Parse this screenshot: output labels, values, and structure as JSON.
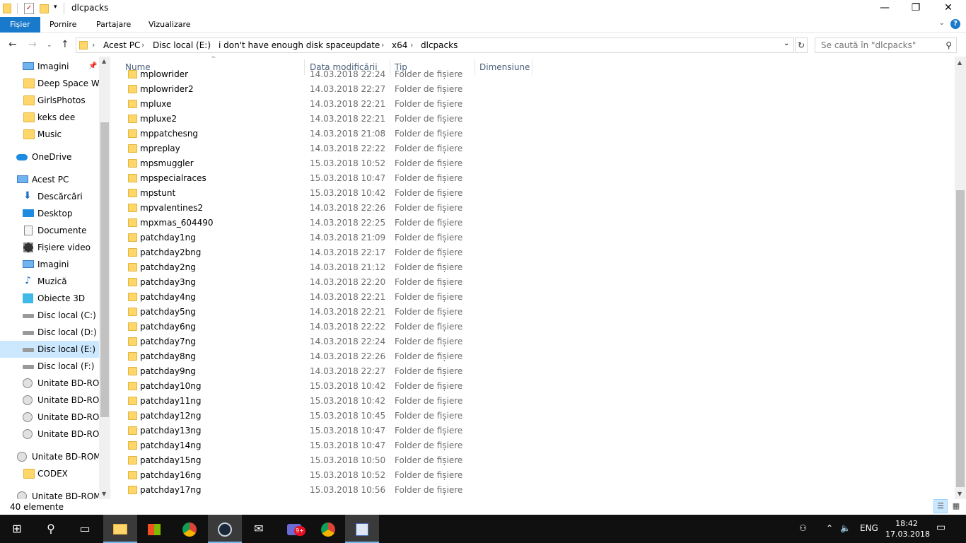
{
  "window": {
    "title": "dlcpacks"
  },
  "ribbon": {
    "tabs": [
      "Fișier",
      "Pornire",
      "Partajare",
      "Vizualizare"
    ]
  },
  "address": {
    "crumbs": [
      "Acest PC",
      "Disc local (E:)",
      "i don't have enough disk space",
      "update",
      "x64",
      "dlcpacks"
    ]
  },
  "search": {
    "placeholder": "Se caută în \"dlcpacks\""
  },
  "nav": {
    "items": [
      {
        "label": "Imagini",
        "icon": "pictures-icon"
      },
      {
        "label": "Deep Space Waifu",
        "icon": "folder-icon"
      },
      {
        "label": "GirlsPhotos",
        "icon": "folder-icon"
      },
      {
        "label": "keks dee",
        "icon": "folder-icon"
      },
      {
        "label": "Music",
        "icon": "folder-icon"
      },
      {
        "label": "OneDrive",
        "icon": "onedrive-icon"
      },
      {
        "label": "Acest PC",
        "icon": "this-pc-icon"
      },
      {
        "label": "Descărcări",
        "icon": "downloads-icon"
      },
      {
        "label": "Desktop",
        "icon": "desktop-icon"
      },
      {
        "label": "Documente",
        "icon": "documents-icon"
      },
      {
        "label": "Fișiere video",
        "icon": "videos-icon"
      },
      {
        "label": "Imagini",
        "icon": "pictures-icon"
      },
      {
        "label": "Muzică",
        "icon": "music-icon"
      },
      {
        "label": "Obiecte 3D",
        "icon": "objects-3d-icon"
      },
      {
        "label": "Disc local (C:)",
        "icon": "drive-icon"
      },
      {
        "label": "Disc local (D:)",
        "icon": "drive-icon"
      },
      {
        "label": "Disc local (E:)",
        "icon": "drive-icon"
      },
      {
        "label": "Disc local (F:)",
        "icon": "drive-icon"
      },
      {
        "label": "Unitate BD-ROM",
        "icon": "bd-drive-icon"
      },
      {
        "label": "Unitate BD-ROM",
        "icon": "bd-drive-icon"
      },
      {
        "label": "Unitate BD-ROM",
        "icon": "bd-drive-icon"
      },
      {
        "label": "Unitate BD-ROM",
        "icon": "disc-icon"
      },
      {
        "label": "Unitate BD-ROM (",
        "icon": "bd-drive-icon"
      },
      {
        "label": "CODEX",
        "icon": "folder-icon"
      },
      {
        "label": "Unitate BD-ROM (",
        "icon": "bd-drive-icon"
      }
    ]
  },
  "columns": {
    "name": "Nume",
    "date": "Data modificării",
    "type": "Tip",
    "size": "Dimensiune"
  },
  "files": [
    {
      "name": "mplowrider",
      "date": "14.03.2018 22:24",
      "type": "Folder de fișiere"
    },
    {
      "name": "mplowrider2",
      "date": "14.03.2018 22:27",
      "type": "Folder de fișiere"
    },
    {
      "name": "mpluxe",
      "date": "14.03.2018 22:21",
      "type": "Folder de fișiere"
    },
    {
      "name": "mpluxe2",
      "date": "14.03.2018 22:21",
      "type": "Folder de fișiere"
    },
    {
      "name": "mppatchesng",
      "date": "14.03.2018 21:08",
      "type": "Folder de fișiere"
    },
    {
      "name": "mpreplay",
      "date": "14.03.2018 22:22",
      "type": "Folder de fișiere"
    },
    {
      "name": "mpsmuggler",
      "date": "15.03.2018 10:52",
      "type": "Folder de fișiere"
    },
    {
      "name": "mpspecialraces",
      "date": "15.03.2018 10:47",
      "type": "Folder de fișiere"
    },
    {
      "name": "mpstunt",
      "date": "15.03.2018 10:42",
      "type": "Folder de fișiere"
    },
    {
      "name": "mpvalentines2",
      "date": "14.03.2018 22:26",
      "type": "Folder de fișiere"
    },
    {
      "name": "mpxmas_604490",
      "date": "14.03.2018 22:25",
      "type": "Folder de fișiere"
    },
    {
      "name": "patchday1ng",
      "date": "14.03.2018 21:09",
      "type": "Folder de fișiere"
    },
    {
      "name": "patchday2bng",
      "date": "14.03.2018 22:17",
      "type": "Folder de fișiere"
    },
    {
      "name": "patchday2ng",
      "date": "14.03.2018 21:12",
      "type": "Folder de fișiere"
    },
    {
      "name": "patchday3ng",
      "date": "14.03.2018 22:20",
      "type": "Folder de fișiere"
    },
    {
      "name": "patchday4ng",
      "date": "14.03.2018 22:21",
      "type": "Folder de fișiere"
    },
    {
      "name": "patchday5ng",
      "date": "14.03.2018 22:21",
      "type": "Folder de fișiere"
    },
    {
      "name": "patchday6ng",
      "date": "14.03.2018 22:22",
      "type": "Folder de fișiere"
    },
    {
      "name": "patchday7ng",
      "date": "14.03.2018 22:24",
      "type": "Folder de fișiere"
    },
    {
      "name": "patchday8ng",
      "date": "14.03.2018 22:26",
      "type": "Folder de fișiere"
    },
    {
      "name": "patchday9ng",
      "date": "14.03.2018 22:27",
      "type": "Folder de fișiere"
    },
    {
      "name": "patchday10ng",
      "date": "15.03.2018 10:42",
      "type": "Folder de fișiere"
    },
    {
      "name": "patchday11ng",
      "date": "15.03.2018 10:42",
      "type": "Folder de fișiere"
    },
    {
      "name": "patchday12ng",
      "date": "15.03.2018 10:45",
      "type": "Folder de fișiere"
    },
    {
      "name": "patchday13ng",
      "date": "15.03.2018 10:47",
      "type": "Folder de fișiere"
    },
    {
      "name": "patchday14ng",
      "date": "15.03.2018 10:47",
      "type": "Folder de fișiere"
    },
    {
      "name": "patchday15ng",
      "date": "15.03.2018 10:50",
      "type": "Folder de fișiere"
    },
    {
      "name": "patchday16ng",
      "date": "15.03.2018 10:52",
      "type": "Folder de fișiere"
    },
    {
      "name": "patchday17ng",
      "date": "15.03.2018 10:56",
      "type": "Folder de fișiere"
    }
  ],
  "status": {
    "count": "40 elemente"
  },
  "taskbar": {
    "language": "ENG",
    "time": "18:42",
    "date": "17.03.2018",
    "badge": "9+"
  },
  "colors": {
    "accent": "#1979ca",
    "selection": "#cce8ff",
    "folder": "#ffd66a",
    "taskbar": "#101010"
  }
}
